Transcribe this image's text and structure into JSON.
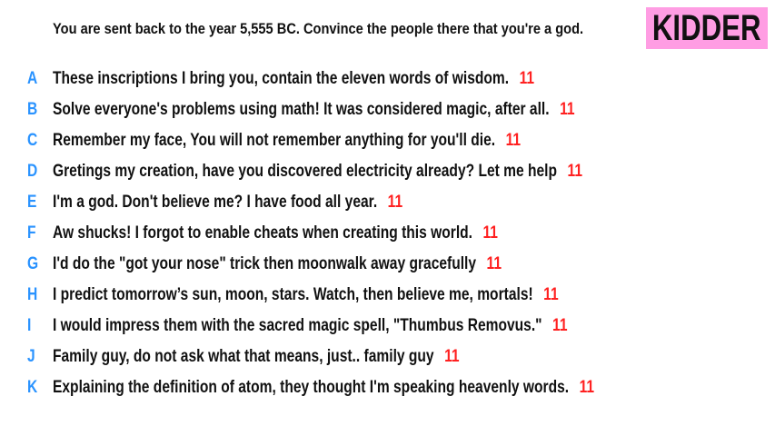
{
  "prompt": "You are sent back to the year 5,555 BC. Convince the people there that you're a god.",
  "brand": "KIDDER",
  "colors": {
    "brand_bg": "#ff9de3",
    "letter": "#2a93ff",
    "score": "#ff2020",
    "text": "#111111"
  },
  "answers": [
    {
      "letter": "A",
      "text": "These inscriptions I bring you, contain the eleven words of wisdom.",
      "score": "11"
    },
    {
      "letter": "B",
      "text": "Solve everyone's problems using math! It was considered magic, after all.",
      "score": "11"
    },
    {
      "letter": "C",
      "text": "Remember my face, You will not remember anything for you'll die.",
      "score": "11"
    },
    {
      "letter": "D",
      "text": "Gretings my creation, have you discovered electricity already? Let me help",
      "score": "11"
    },
    {
      "letter": "E",
      "text": "I'm a god. Don't believe me? I have food all year.",
      "score": "11"
    },
    {
      "letter": "F",
      "text": "Aw shucks! I forgot to enable cheats when creating this world.",
      "score": "11"
    },
    {
      "letter": "G",
      "text": "I'd do the \"got your nose\" trick then moonwalk away gracefully",
      "score": "11"
    },
    {
      "letter": "H",
      "text": "I predict tomorrow’s sun, moon, stars. Watch, then believe me, mortals!",
      "score": "11"
    },
    {
      "letter": "I",
      "text": "I would impress them with the sacred magic spell, \"Thumbus Removus.\"",
      "score": "11"
    },
    {
      "letter": "J",
      "text": "Family guy, do not ask what that means, just.. family guy",
      "score": "11"
    },
    {
      "letter": "K",
      "text": "Explaining the definition of atom, they thought I'm speaking heavenly words.",
      "score": "11"
    }
  ]
}
